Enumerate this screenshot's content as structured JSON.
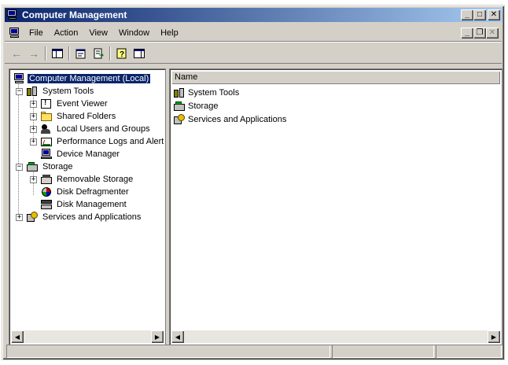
{
  "window": {
    "title": "Computer Management"
  },
  "titlebar_buttons": {
    "minimize": "_",
    "maximize": "□",
    "close": "✕"
  },
  "menu": [
    "File",
    "Action",
    "View",
    "Window",
    "Help"
  ],
  "mdi_buttons": {
    "minimize": "_",
    "restore": "❐",
    "close": "✕"
  },
  "toolbar": {
    "icons": [
      "back-arrow-icon",
      "forward-arrow-icon",
      "show-hide-tree-icon",
      "properties-icon",
      "export-list-icon",
      "help-icon",
      "show-hide-action-pane-icon"
    ],
    "back": "←",
    "forward": "→"
  },
  "tree": {
    "root": "Computer Management (Local)",
    "system_tools": "System Tools",
    "event_viewer": "Event Viewer",
    "shared_folders": "Shared Folders",
    "local_users": "Local Users and Groups",
    "perf_logs": "Performance Logs and Alerts",
    "device_manager": "Device Manager",
    "storage": "Storage",
    "removable_storage": "Removable Storage",
    "disk_defrag": "Disk Defragmenter",
    "disk_mgmt": "Disk Management",
    "services_apps": "Services and Applications",
    "expand": "+",
    "collapse": "−"
  },
  "list": {
    "column_name": "Name",
    "items": [
      "System Tools",
      "Storage",
      "Services and Applications"
    ]
  },
  "scroll": {
    "left": "◀",
    "right": "▶"
  },
  "colors": {
    "titlebar_start": "#0a246a",
    "titlebar_end": "#a6caf0",
    "selection": "#0a246a",
    "chrome": "#d4d0c8"
  }
}
